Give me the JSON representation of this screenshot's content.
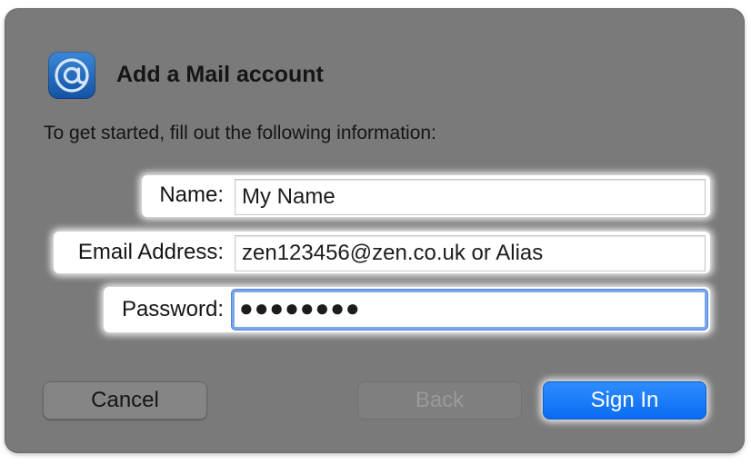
{
  "dialog": {
    "title": "Add a Mail account",
    "subtitle": "To get started, fill out the following information:",
    "icon": "mail-at-icon"
  },
  "form": {
    "name_label": "Name:",
    "name_value": "My Name",
    "email_label": "Email Address:",
    "email_value": "zen123456@zen.co.uk or Alias",
    "password_label": "Password:",
    "password_value": "●●●●●●●●"
  },
  "buttons": {
    "cancel": "Cancel",
    "back": "Back",
    "sign_in": "Sign In"
  },
  "colors": {
    "dialog_background": "#7a7a7a",
    "accent": "#0a6cf1",
    "focus_ring": "#7aa6ea"
  }
}
